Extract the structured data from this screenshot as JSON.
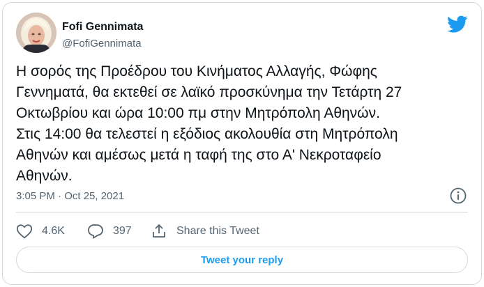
{
  "author": {
    "name": "Fofi Gennimata",
    "handle": "@FofiGennimata",
    "avatar_icon": "profile-photo"
  },
  "tweet": {
    "text": "Η σορός της Προέδρου του Κινήματος Αλλαγής, Φώφης\nΓεννηματά, θα εκτεθεί σε λαϊκό προσκύνημα την Τετάρτη 27\nΟκτωβρίου και ώρα 10:00 πμ στην Μητρόπολη Αθηνών.\nΣτις 14:00 θα τελεστεί η εξόδιος ακολουθία στη Μητρόπολη\nΑθηνών και αμέσως μετά η ταφή της στο Α' Νεκροταφείο\nΑθηνών.",
    "timestamp": "3:05 PM · Oct 25, 2021"
  },
  "actions": {
    "likes": "4.6K",
    "replies": "397",
    "share_label": "Share this Tweet"
  },
  "reply_button": "Tweet your reply",
  "icons": {
    "brand": "twitter-bird-icon",
    "info": "info-icon",
    "like": "heart-icon",
    "reply": "speech-bubble-icon",
    "share": "share-icon"
  },
  "colors": {
    "brand_blue": "#1d9bf0",
    "secondary_text": "#536471",
    "border": "#cfd9de"
  }
}
